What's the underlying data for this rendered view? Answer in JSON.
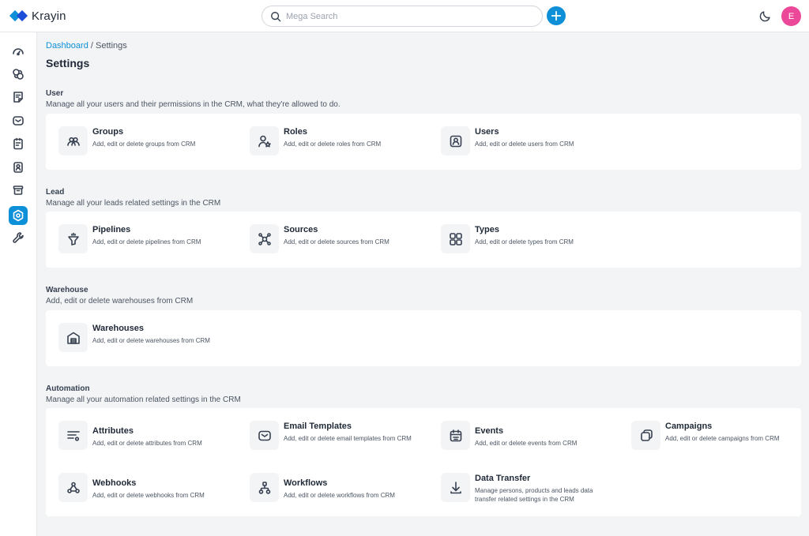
{
  "app": {
    "name": "Krayin"
  },
  "header": {
    "search_placeholder": "Mega Search",
    "avatar_initial": "E"
  },
  "sidebar": {
    "items": [
      {
        "name": "dashboard",
        "icon": "dashboard-gauge-icon"
      },
      {
        "name": "leads",
        "icon": "leads-icon"
      },
      {
        "name": "quotes",
        "icon": "quotes-icon"
      },
      {
        "name": "mail",
        "icon": "mail-icon"
      },
      {
        "name": "activities",
        "icon": "activities-icon"
      },
      {
        "name": "contacts",
        "icon": "contacts-icon"
      },
      {
        "name": "products",
        "icon": "products-icon"
      },
      {
        "name": "settings",
        "icon": "settings-icon",
        "active": true
      },
      {
        "name": "configuration",
        "icon": "wrench-icon"
      }
    ]
  },
  "breadcrumb": {
    "parent": "Dashboard",
    "separator": " / ",
    "current": "Settings"
  },
  "page": {
    "title": "Settings"
  },
  "sections": {
    "user": {
      "title": "User",
      "description": "Manage all your users and their permissions in the CRM, what they're allowed to do.",
      "items": [
        {
          "title": "Groups",
          "description": "Add, edit or delete groups from CRM"
        },
        {
          "title": "Roles",
          "description": "Add, edit or delete roles from CRM"
        },
        {
          "title": "Users",
          "description": "Add, edit or delete users from CRM"
        }
      ]
    },
    "lead": {
      "title": "Lead",
      "description": "Manage all your leads related settings in the CRM",
      "items": [
        {
          "title": "Pipelines",
          "description": "Add, edit or delete pipelines from CRM"
        },
        {
          "title": "Sources",
          "description": "Add, edit or delete sources from CRM"
        },
        {
          "title": "Types",
          "description": "Add, edit or delete types from CRM"
        }
      ]
    },
    "warehouse": {
      "title": "Warehouse",
      "description": "Add, edit or delete warehouses from CRM",
      "items": [
        {
          "title": "Warehouses",
          "description": "Add, edit or delete warehouses from CRM"
        }
      ]
    },
    "automation": {
      "title": "Automation",
      "description": "Manage all your automation related settings in the CRM",
      "items": [
        {
          "title": "Attributes",
          "description": "Add, edit or delete attributes from CRM"
        },
        {
          "title": "Email Templates",
          "description": "Add, edit or delete email templates from CRM"
        },
        {
          "title": "Events",
          "description": "Add, edit or delete events from CRM"
        },
        {
          "title": "Campaigns",
          "description": "Add, edit or delete campaigns from CRM"
        },
        {
          "title": "Webhooks",
          "description": "Add, edit or delete webhooks from CRM"
        },
        {
          "title": "Workflows",
          "description": "Add, edit or delete workflows from CRM"
        },
        {
          "title": "Data Transfer",
          "description": "Manage persons, products and leads data transfer related settings in the CRM"
        }
      ]
    }
  },
  "colors": {
    "accent": "#0E90D9",
    "avatar": "#ec4899",
    "background": "#f3f4f6"
  }
}
